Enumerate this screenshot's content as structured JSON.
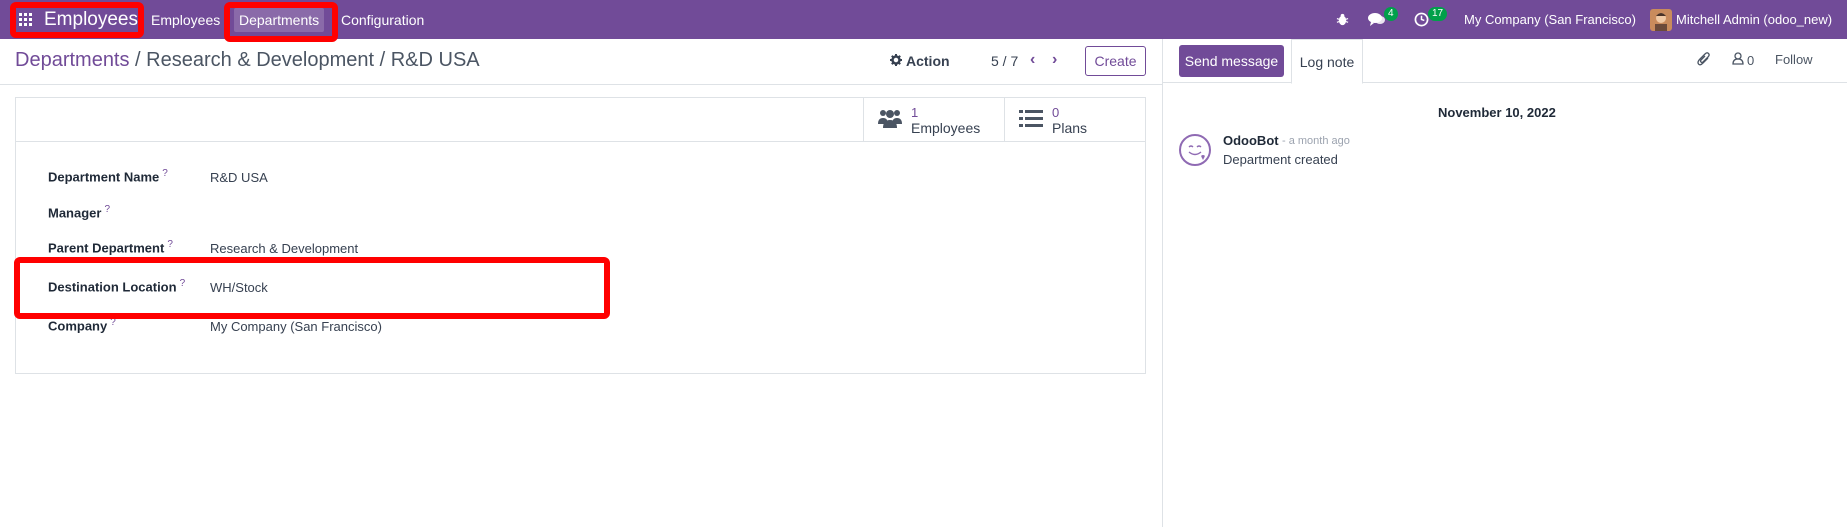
{
  "navbar": {
    "app_name": "Employees",
    "menu": [
      "Employees",
      "Departments",
      "Configuration"
    ],
    "messages_count": "4",
    "activities_count": "17",
    "company": "My Company (San Francisco)",
    "user": "Mitchell Admin (odoo_new)"
  },
  "breadcrumb": {
    "root": "Departments",
    "separator": " / ",
    "middle": "Research & Development",
    "current": "R&D USA"
  },
  "control": {
    "action_label": "Action",
    "pager": "5 / 7",
    "create_label": "Create"
  },
  "stat_buttons": [
    {
      "value": "1",
      "label": "Employees",
      "icon": "users-icon"
    },
    {
      "value": "0",
      "label": "Plans",
      "icon": "list-icon"
    }
  ],
  "form": {
    "fields": [
      {
        "label": "Department Name",
        "value": "R&D USA"
      },
      {
        "label": "Manager",
        "value": ""
      },
      {
        "label": "Parent Department",
        "value": "Research & Development"
      },
      {
        "label": "Destination Location",
        "value": "WH/Stock"
      },
      {
        "label": "Company",
        "value": "My Company (San Francisco)"
      }
    ],
    "help_mark": "?"
  },
  "chatter": {
    "send_message": "Send message",
    "log_note": "Log note",
    "followers_count": "0",
    "follow_label": "Follow",
    "date": "November 10, 2022",
    "message": {
      "author": "OdooBot",
      "time": "- a month ago",
      "body": "Department created"
    }
  },
  "colors": {
    "brand": "#714B98",
    "highlight": "#ff0000",
    "badge": "#00a04a"
  }
}
